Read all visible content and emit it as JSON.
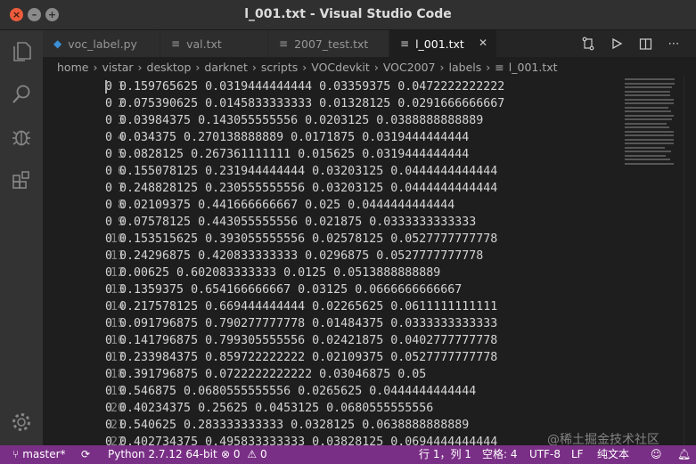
{
  "window": {
    "title": "l_001.txt - Visual Studio Code"
  },
  "tabs": [
    {
      "label": "voc_label.py",
      "icon": "python-icon"
    },
    {
      "label": "val.txt",
      "icon": "text-file-icon"
    },
    {
      "label": "2007_test.txt",
      "icon": "text-file-icon"
    },
    {
      "label": "l_001.txt",
      "icon": "text-file-icon",
      "active": true
    }
  ],
  "breadcrumb": [
    "home",
    "vistar",
    "desktop",
    "darknet",
    "scripts",
    "VOCdevkit",
    "VOC2007",
    "labels",
    "l_001.txt"
  ],
  "lines": [
    {
      "n": "1",
      "text": "0 0.159765625 0.0319444444444 0.03359375 0.0472222222222"
    },
    {
      "n": "2",
      "text": "0 0.075390625 0.0145833333333 0.01328125 0.0291666666667"
    },
    {
      "n": "3",
      "text": "0 0.03984375 0.143055555556 0.0203125 0.0388888888889"
    },
    {
      "n": "4",
      "text": "0 0.034375 0.270138888889 0.0171875 0.0319444444444"
    },
    {
      "n": "5",
      "text": "0 0.0828125 0.267361111111 0.015625 0.0319444444444"
    },
    {
      "n": "6",
      "text": "0 0.155078125 0.231944444444 0.03203125 0.0444444444444"
    },
    {
      "n": "7",
      "text": "0 0.248828125 0.230555555556 0.03203125 0.0444444444444"
    },
    {
      "n": "8",
      "text": "0 0.02109375 0.441666666667 0.025 0.0444444444444"
    },
    {
      "n": "9",
      "text": "0 0.07578125 0.443055555556 0.021875 0.0333333333333"
    },
    {
      "n": "10",
      "text": "0 0.153515625 0.393055555556 0.02578125 0.0527777777778"
    },
    {
      "n": "11",
      "text": "0 0.24296875 0.420833333333 0.0296875 0.0527777777778"
    },
    {
      "n": "12",
      "text": "0 0.00625 0.602083333333 0.0125 0.0513888888889"
    },
    {
      "n": "13",
      "text": "0 0.1359375 0.654166666667 0.03125 0.0666666666667"
    },
    {
      "n": "14",
      "text": "0 0.217578125 0.669444444444 0.02265625 0.0611111111111"
    },
    {
      "n": "15",
      "text": "0 0.091796875 0.790277777778 0.01484375 0.0333333333333"
    },
    {
      "n": "16",
      "text": "0 0.141796875 0.799305555556 0.02421875 0.0402777777778"
    },
    {
      "n": "17",
      "text": "0 0.233984375 0.859722222222 0.02109375 0.0527777777778"
    },
    {
      "n": "18",
      "text": "0 0.391796875 0.0722222222222 0.03046875 0.05"
    },
    {
      "n": "19",
      "text": "0 0.546875 0.0680555555556 0.0265625 0.0444444444444"
    },
    {
      "n": "20",
      "text": "0 0.40234375 0.25625 0.0453125 0.0680555555556"
    },
    {
      "n": "21",
      "text": "0 0.540625 0.283333333333 0.0328125 0.0638888888889"
    },
    {
      "n": "22",
      "text": "0 0.402734375 0.495833333333 0.03828125 0.0694444444444"
    }
  ],
  "status": {
    "branch": "master*",
    "python": "Python 2.7.12 64-bit",
    "errors": "0",
    "warnings": "0",
    "position": "行 1，列 1",
    "spaces": "空格: 4",
    "encoding": "UTF-8",
    "eol": "LF",
    "language": "纯文本"
  },
  "watermark": "@稀土掘金技术社区",
  "colors": {
    "statusbar": "#7a2f86",
    "editor_bg": "#1e1e1e",
    "activity_bg": "#333333"
  }
}
